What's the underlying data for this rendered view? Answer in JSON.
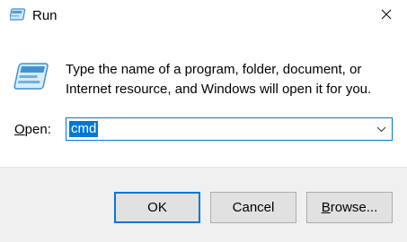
{
  "window": {
    "title": "Run",
    "close_label": "×"
  },
  "prompt": {
    "line1": "Type the name of a program, folder, document, or",
    "line2": "Internet resource, and Windows will open it for you."
  },
  "open_field": {
    "label_accel": "O",
    "label_rest": "pen:",
    "value": "cmd"
  },
  "buttons": {
    "ok": "OK",
    "cancel": "Cancel",
    "browse_accel": "B",
    "browse_rest": "rowse..."
  },
  "colors": {
    "accent": "#0078d7",
    "footer_bg": "#f0f0f0",
    "button_bg": "#e1e1e1"
  },
  "icons": {
    "title": "run-icon",
    "large": "run-icon",
    "close": "close-icon",
    "dropdown": "chevron-down-icon"
  }
}
